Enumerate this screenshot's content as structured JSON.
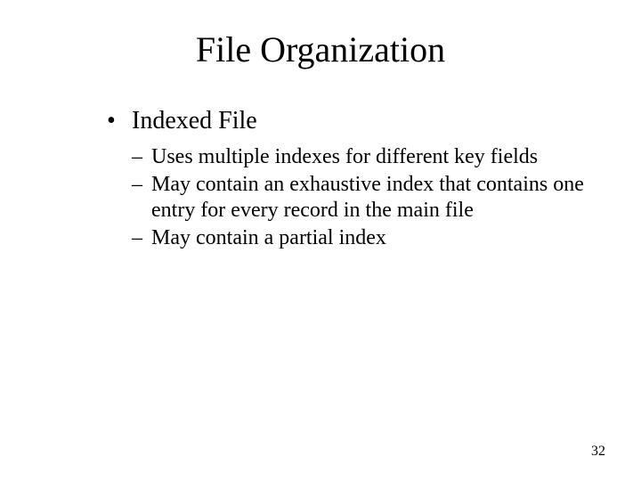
{
  "title": "File Organization",
  "level1_bullet": "•",
  "level1_text": "Indexed File",
  "dash": "–",
  "sub_items": [
    "Uses multiple indexes for different key fields",
    "May contain an exhaustive index that contains one entry for every record in the main file",
    "May contain a partial index"
  ],
  "page_number": "32"
}
